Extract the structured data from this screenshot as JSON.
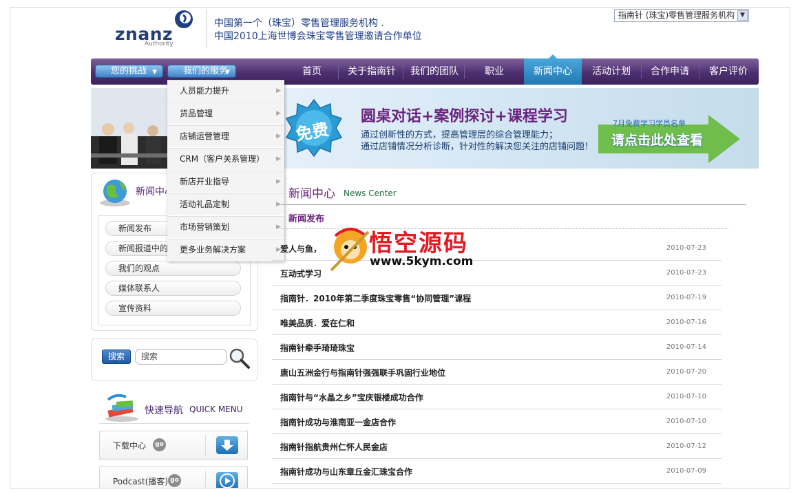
{
  "header": {
    "logo_text": "znanz",
    "logo_sub": "Authority",
    "tagline_1": "中国第一个（珠宝）零售管理服务机构 .",
    "tagline_2": "中国2010上海世博会珠宝零售管理邀请合作单位",
    "top_select_value": "指南针 (珠宝)零售管理服务机构"
  },
  "nav": {
    "pill_1": "您的挑战",
    "pill_2": "我们的服务",
    "items": [
      "首页",
      "关于指南针",
      "我们的团队",
      "职业",
      "新闻中心",
      "活动计划",
      "合作申请",
      "客户评价"
    ],
    "active_index": 4
  },
  "dropdown": {
    "items": [
      "人员能力提升",
      "货品管理",
      "店铺运营管理",
      "CRM（客户关系管理）",
      "新店开业指导",
      "活动礼品定制",
      "市场营销策划",
      "更多业务解决方案"
    ]
  },
  "banner": {
    "badge": "免费",
    "title": "圆桌对话+案例探讨+课程学习",
    "line_1": "通过创新性的方式，提高管理层的综合管理能力；",
    "line_2": "通过店铺情况分析诊断，针对性的解决您关注的店铺问题！",
    "promo_small": "7月免费学习学员名单",
    "promo_big": "请点击此处查看"
  },
  "sidebar": {
    "title": "新闻中心",
    "links": [
      "新闻发布",
      "新闻报道中的",
      "我们的观点",
      "媒体联系人",
      "宣传资料"
    ],
    "search_button": "搜索",
    "search_value": "搜索",
    "quick_title": "快速导航",
    "quick_en": "QUICK MENU",
    "quick_items": [
      "下载中心",
      "Podcast(播客)"
    ],
    "go_label": "go"
  },
  "news": {
    "title": "新闻中心",
    "title_en": "News Center",
    "sub": "新闻发布",
    "rows": [
      {
        "title": "爱人与鱼，",
        "date": "2010-07-23"
      },
      {
        "title": "互动式学习",
        "date": "2010-07-23"
      },
      {
        "title": "指南针．2010年第二季度珠宝零售“协同管理”课程",
        "date": "2010-07-19"
      },
      {
        "title": "唯美品质．爱在仁和",
        "date": "2010-07-16"
      },
      {
        "title": "指南针牵手琦琦珠宝",
        "date": "2010-07-14"
      },
      {
        "title": "唐山五洲金行与指南针强强联手巩固行业地位",
        "date": "2010-07-20"
      },
      {
        "title": "指南针与“水晶之乡”宝庆银楼成功合作",
        "date": "2010-07-10"
      },
      {
        "title": "指南针成功与淮南亚一金店合作",
        "date": "2010-07-10"
      },
      {
        "title": "指南针指航贵州仁怀人民金店",
        "date": "2010-07-12"
      },
      {
        "title": "指南针成功与山东章丘金汇珠宝合作",
        "date": "2010-07-09"
      }
    ]
  },
  "watermark": {
    "text": "悟空源码",
    "url": "www.5kym.com"
  },
  "colors": {
    "nav_purple": "#4d2f70",
    "nav_active": "#2178b2",
    "title_purple": "#6a237e",
    "brand_blue": "#233e77"
  }
}
